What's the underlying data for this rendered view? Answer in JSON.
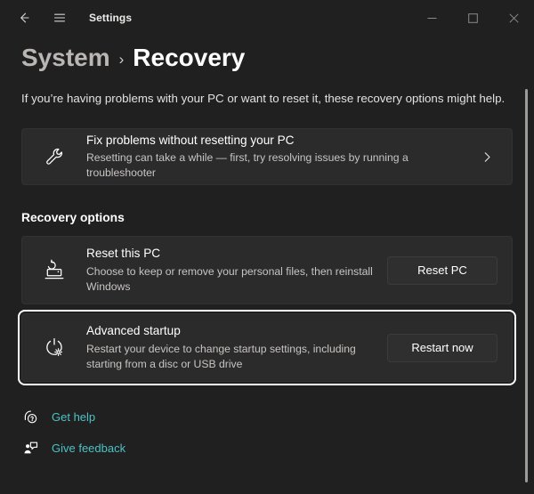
{
  "window": {
    "app_title": "Settings",
    "back_icon": "arrow-left-icon",
    "menu_icon": "hamburger-menu-icon",
    "minimize_label": "–",
    "maximize_label": "□",
    "close_label": "✕"
  },
  "breadcrumb": {
    "parent": "System",
    "separator": "›",
    "current": "Recovery"
  },
  "page": {
    "description": "If you’re having problems with your PC or want to reset it, these recovery options might help."
  },
  "fix_problems_card": {
    "icon": "wrench-icon",
    "title": "Fix problems without resetting your PC",
    "subtitle": "Resetting can take a while — first, try resolving issues by running a troubleshooter",
    "chevron": "›"
  },
  "recovery_options": {
    "heading": "Recovery options",
    "items": [
      {
        "icon": "reset-pc-icon",
        "title": "Reset this PC",
        "subtitle": "Choose to keep or remove your personal files, then reinstall Windows",
        "button_label": "Reset PC",
        "focused": false
      },
      {
        "icon": "advanced-startup-icon",
        "title": "Advanced startup",
        "subtitle": "Restart your device to change startup settings, including starting from a disc or USB drive",
        "button_label": "Restart now",
        "focused": true
      }
    ]
  },
  "footer": {
    "links": [
      {
        "icon": "get-help-icon",
        "label": "Get help"
      },
      {
        "icon": "give-feedback-icon",
        "label": "Give feedback"
      }
    ]
  },
  "colors": {
    "page_background": "#202020",
    "card_background": "#2b2b2b",
    "accent_link": "#4cc2c4",
    "focus_ring": "#ffffff"
  }
}
